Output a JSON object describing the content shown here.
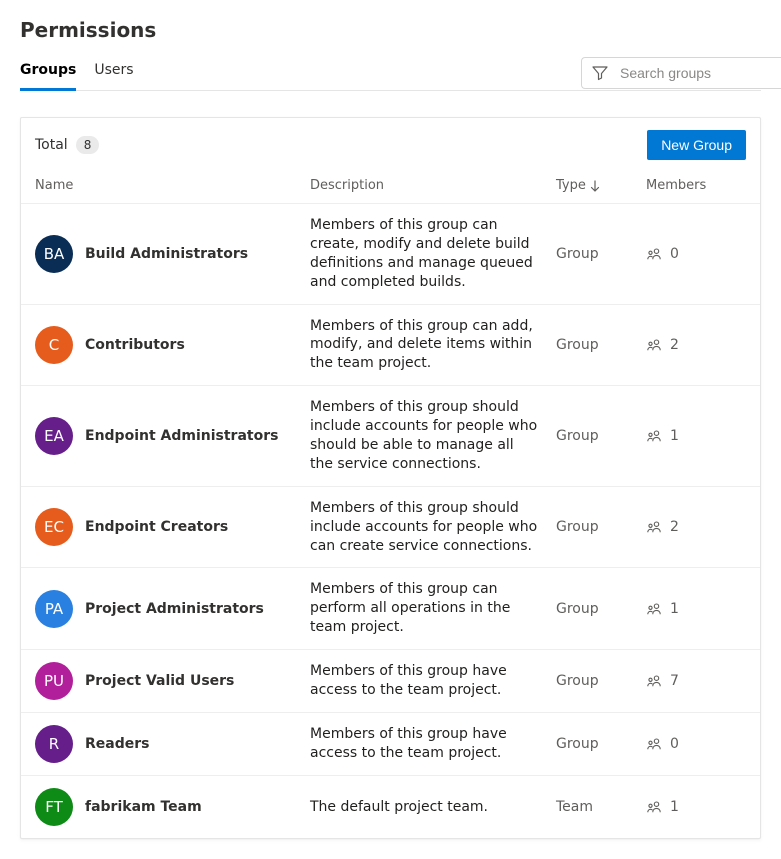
{
  "header": {
    "title": "Permissions"
  },
  "tabs": {
    "items": [
      {
        "label": "Groups",
        "active": true
      },
      {
        "label": "Users",
        "active": false
      }
    ]
  },
  "search": {
    "placeholder": "Search groups"
  },
  "panel": {
    "total_label": "Total",
    "total_count": "8",
    "new_group_label": "New Group"
  },
  "columns": {
    "name": "Name",
    "description": "Description",
    "type": "Type",
    "members": "Members"
  },
  "groups": [
    {
      "initials": "BA",
      "color": "#0a2d55",
      "name": "Build Administrators",
      "description": "Members of this group can create, modify and delete build definitions and manage queued and completed builds.",
      "type": "Group",
      "members": "0"
    },
    {
      "initials": "C",
      "color": "#e65c1c",
      "name": "Contributors",
      "description": "Members of this group can add, modify, and delete items within the team project.",
      "type": "Group",
      "members": "2"
    },
    {
      "initials": "EA",
      "color": "#661e8b",
      "name": "Endpoint Administrators",
      "description": "Members of this group should include accounts for people who should be able to manage all the service connections.",
      "type": "Group",
      "members": "1"
    },
    {
      "initials": "EC",
      "color": "#e65c1c",
      "name": "Endpoint Creators",
      "description": "Members of this group should include accounts for people who can create service connections.",
      "type": "Group",
      "members": "2"
    },
    {
      "initials": "PA",
      "color": "#2a80e0",
      "name": "Project Administrators",
      "description": "Members of this group can perform all operations in the team project.",
      "type": "Group",
      "members": "1"
    },
    {
      "initials": "PU",
      "color": "#b21f9a",
      "name": "Project Valid Users",
      "description": "Members of this group have access to the team project.",
      "type": "Group",
      "members": "7"
    },
    {
      "initials": "R",
      "color": "#661e8b",
      "name": "Readers",
      "description": "Members of this group have access to the team project.",
      "type": "Group",
      "members": "0"
    },
    {
      "initials": "FT",
      "color": "#0e8a16",
      "name": "fabrikam Team",
      "description": "The default project team.",
      "type": "Team",
      "members": "1"
    }
  ]
}
